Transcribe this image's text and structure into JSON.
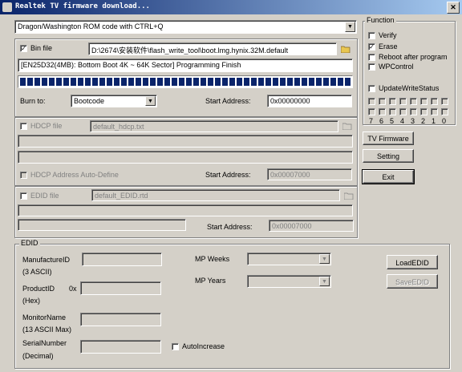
{
  "window": {
    "title": "Realtek TV firmware download...",
    "close_glyph": "✕"
  },
  "platform": {
    "selected": "Dragon/Washington ROM code with CTRL+Q"
  },
  "bin": {
    "label": "Bin file",
    "checked": true,
    "path": "D:\\2674\\安装软件\\flash_write_tool\\boot.lmg.hynix.32M.default"
  },
  "status": {
    "message": "[EN25D32(4MB): Bottom Boot 4K ~ 64K Sector] Programming Finish",
    "progress": 1.0
  },
  "burn_to": {
    "label": "Burn to:",
    "selected": "Bootcode"
  },
  "start1": {
    "label": "Start Address:",
    "value": "0x00000000"
  },
  "hdcp": {
    "label": "HDCP file",
    "path": "default_hdcp.txt",
    "auto_label": "HDCP Address Auto-Define",
    "start_label": "Start Address:",
    "start_value": "0x00007000"
  },
  "edid": {
    "label": "EDID file",
    "path": "default_EDID.rtd",
    "start_label": "Start Address:",
    "start_value": "0x00007000"
  },
  "function": {
    "title": "Function",
    "verify": "Verify",
    "erase": "Erase",
    "reboot": "Reboot after program",
    "wpcontrol": "WPControl",
    "update_status": "UpdateWriteStatus",
    "bit_labels": [
      "7",
      "6",
      "5",
      "4",
      "3",
      "2",
      "1",
      "0"
    ]
  },
  "buttons": {
    "tv_firmware": "TV Firmware",
    "setting": "Setting",
    "exit": "Exit",
    "load_edid": "LoadEDID",
    "save_edid": "SaveEDID"
  },
  "edid_group": {
    "title": "EDID",
    "manufacture_id": "ManufactureID",
    "manufacture_id_sub": "(3 ASCII)",
    "product_id": "ProductID",
    "product_id_prefix": "0x",
    "product_id_sub": "(Hex)",
    "monitor_name": "MonitorName",
    "monitor_name_sub": "(13 ASCII Max)",
    "serial_number": "SerialNumber",
    "serial_number_sub": "(Decimal)",
    "mp_weeks": "MP Weeks",
    "mp_years": "MP Years",
    "auto_increase": "AutoIncrease"
  },
  "icons": {
    "dropdown_arrow": "▼",
    "check": "✓"
  },
  "colors": {
    "window_bg": "#d4d0c8",
    "title_start": "#0a246a",
    "title_end": "#a6caf0",
    "progress": "#0a246a"
  }
}
